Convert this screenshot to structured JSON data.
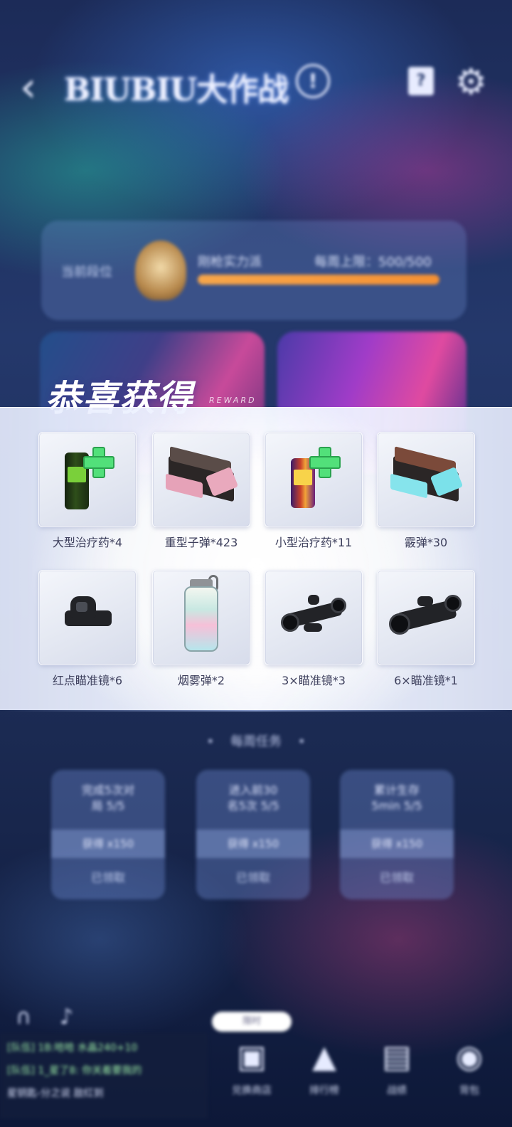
{
  "header": {
    "back_icon": "chevron-left-icon",
    "title": "BIUBIU大作战",
    "info_icon": "info-icon",
    "help_icon": "help-book-icon",
    "settings_icon": "gear-icon"
  },
  "rank": {
    "label": "当前段位",
    "name": "刚枪实力派",
    "limit": "每周上限：500/500",
    "progress": 1.0
  },
  "reward": {
    "title": "恭喜获得",
    "subtitle": "REWARD",
    "items": [
      {
        "label": "大型治疗药*4",
        "icon": "large-medkit-can-icon"
      },
      {
        "label": "重型子弹*423",
        "icon": "heavy-ammo-box-icon"
      },
      {
        "label": "小型治疗药*11",
        "icon": "small-medkit-can-icon"
      },
      {
        "label": "霰弹*30",
        "icon": "shotgun-shell-box-icon"
      },
      {
        "label": "红点瞄准镜*6",
        "icon": "red-dot-sight-icon"
      },
      {
        "label": "烟雾弹*2",
        "icon": "smoke-grenade-icon"
      },
      {
        "label": "3×瞄准镜*3",
        "icon": "3x-scope-icon"
      },
      {
        "label": "6×瞄准镜*1",
        "icon": "6x-scope-icon"
      }
    ]
  },
  "tasks": {
    "header": "每周任务",
    "cards": [
      {
        "title": "完成5次对\n局 5/5",
        "reward": "获得 x150",
        "status": "已领取"
      },
      {
        "title": "进入前30\n名5次 5/5",
        "reward": "获得 x150",
        "status": "已领取"
      },
      {
        "title": "累计生存\n5min 5/5",
        "reward": "获得 x150",
        "status": "已领取"
      }
    ]
  },
  "chat": {
    "lines": [
      "[队伍] 1B:哈哈  水晶240+10",
      "[队伍] 1_星了8:  你关着要我的",
      "星钥匙-分之说 敌红到"
    ]
  },
  "nav": {
    "pill": "限时",
    "items": [
      {
        "label": "兑换商店",
        "icon": "gift-icon"
      },
      {
        "label": "排行榜",
        "icon": "trophy-icon"
      },
      {
        "label": "战绩",
        "icon": "clipboard-icon"
      },
      {
        "label": "背包",
        "icon": "backpack-icon"
      }
    ]
  },
  "colors": {
    "progress": "#f59033",
    "bg_top": "#1c2b58",
    "reward_text": "#3d3f5c"
  }
}
